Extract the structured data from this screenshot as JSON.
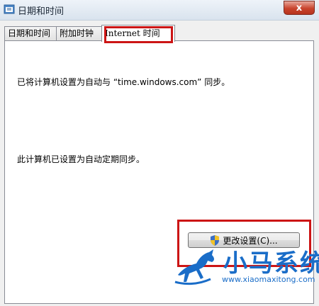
{
  "window": {
    "title": "日期和时间",
    "close_label": "x"
  },
  "tabs": [
    {
      "label": "日期和时间"
    },
    {
      "label": "附加时钟"
    },
    {
      "label": "Internet 时间",
      "active": true
    }
  ],
  "panel": {
    "sync_status": "已将计算机设置为自动与 “time.windows.com” 同步。",
    "sync_schedule": "此计算机已设置为自动定期同步。",
    "change_button_label": "更改设置(C)..."
  },
  "watermark": {
    "brand": "小马系统",
    "url": "www.xiaomaxitong.com"
  },
  "colors": {
    "highlight": "#cc1515",
    "brand": "#1a6dc8"
  }
}
